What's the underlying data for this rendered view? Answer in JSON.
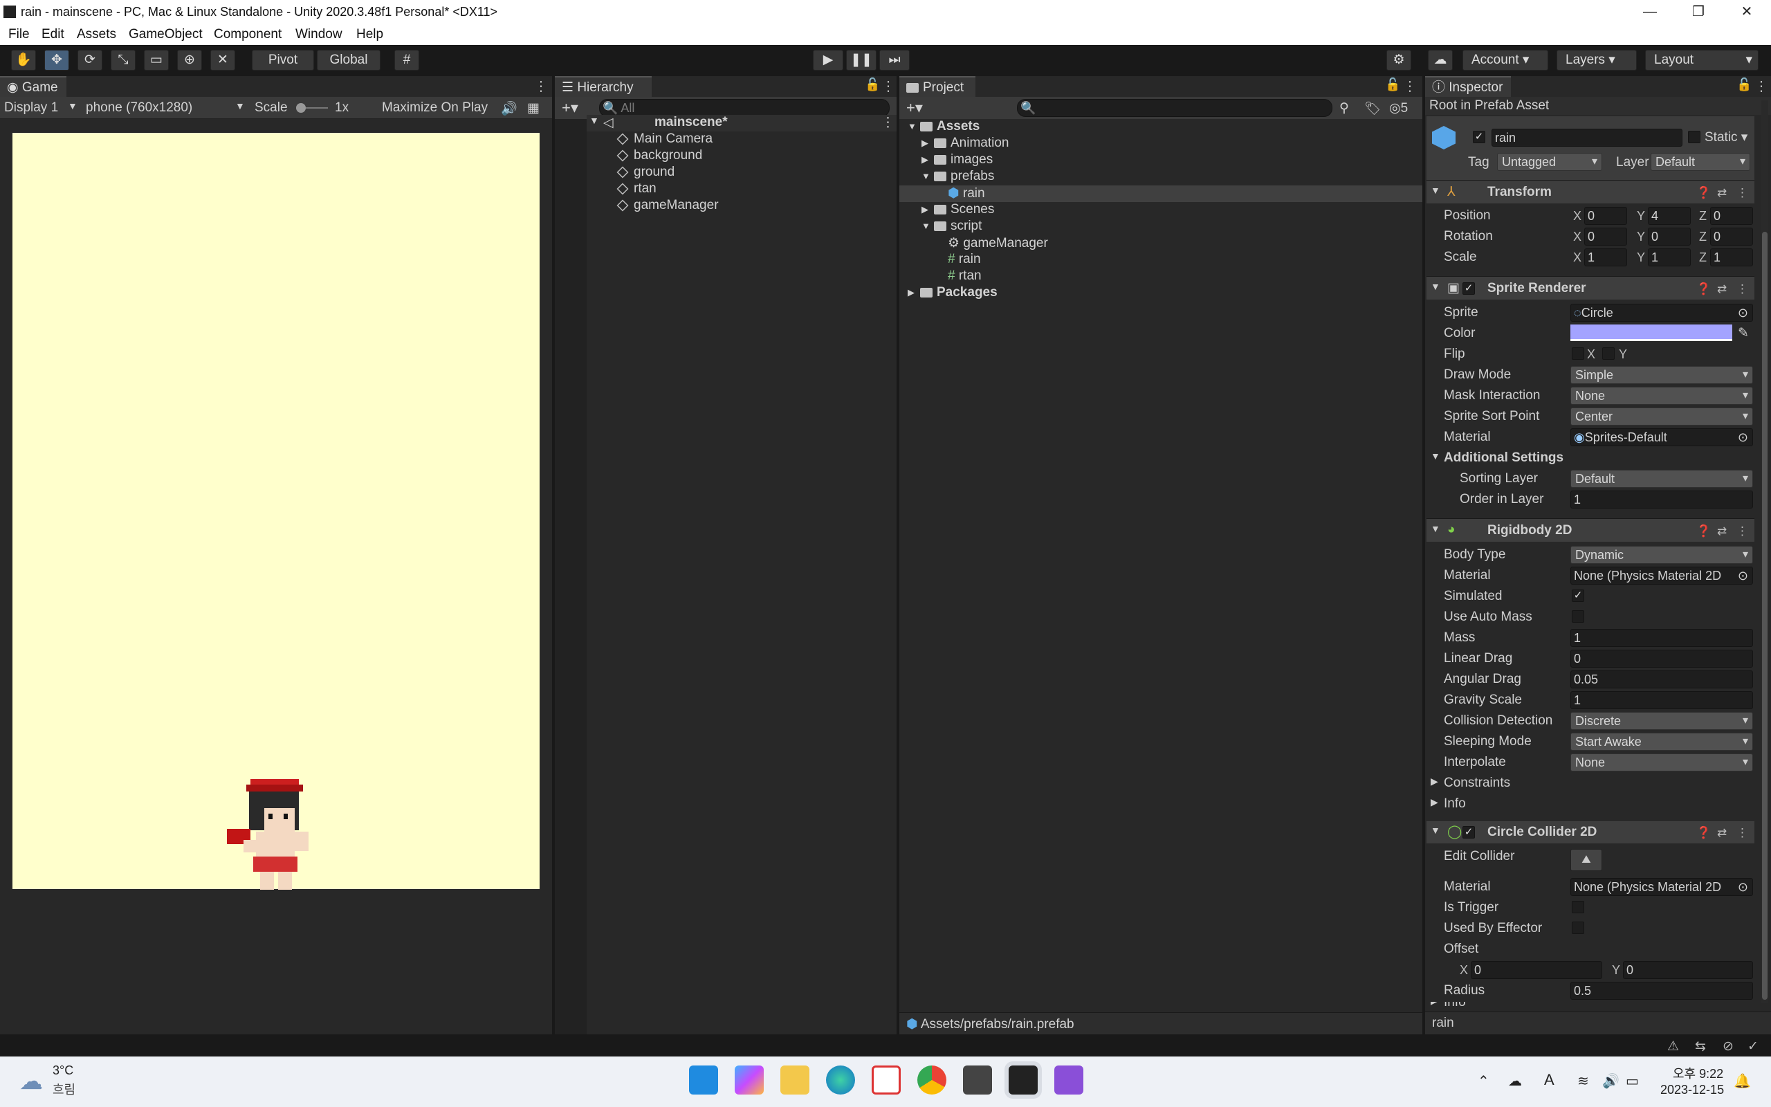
{
  "window": {
    "title": "rain - mainscene - PC, Mac & Linux Standalone - Unity 2020.3.48f1 Personal* <DX11>",
    "min": "—",
    "max": "❐",
    "close": "✕"
  },
  "menu": [
    "File",
    "Edit",
    "Assets",
    "GameObject",
    "Component",
    "Window",
    "Help"
  ],
  "toolbar": {
    "pivot": "Pivot",
    "global": "Global",
    "account": "Account",
    "layers": "Layers",
    "layout": "Layout"
  },
  "game": {
    "tab": "Game",
    "display": "Display 1",
    "resolution": "phone (760x1280)",
    "scale_label": "Scale",
    "scale_value": "1x",
    "maximize": "Maximize On Play",
    "bg_color": "#ffffcc"
  },
  "hierarchy": {
    "tab": "Hierarchy",
    "search_placeholder": "All",
    "scene": "mainscene*",
    "items": [
      "Main Camera",
      "background",
      "ground",
      "rtan",
      "gameManager"
    ]
  },
  "project": {
    "tab": "Project",
    "hidden_count": "5",
    "tree": [
      {
        "label": "Assets",
        "depth": 0,
        "type": "folder",
        "open": true,
        "bold": true
      },
      {
        "label": "Animation",
        "depth": 1,
        "type": "folder",
        "open": false
      },
      {
        "label": "images",
        "depth": 1,
        "type": "folder",
        "open": false
      },
      {
        "label": "prefabs",
        "depth": 1,
        "type": "folder",
        "open": true
      },
      {
        "label": "rain",
        "depth": 2,
        "type": "prefab",
        "selected": true
      },
      {
        "label": "Scenes",
        "depth": 1,
        "type": "folder",
        "open": false
      },
      {
        "label": "script",
        "depth": 1,
        "type": "folder",
        "open": true
      },
      {
        "label": "gameManager",
        "depth": 2,
        "type": "gear"
      },
      {
        "label": "rain",
        "depth": 2,
        "type": "script"
      },
      {
        "label": "rtan",
        "depth": 2,
        "type": "script"
      },
      {
        "label": "Packages",
        "depth": 0,
        "type": "folder",
        "open": false,
        "bold": true
      }
    ],
    "path": "Assets/prefabs/rain.prefab"
  },
  "inspector": {
    "tab": "Inspector",
    "breadcrumb": "Root in Prefab Asset",
    "name": "rain",
    "static_label": "Static",
    "tag_label": "Tag",
    "tag": "Untagged",
    "layer_label": "Layer",
    "layer": "Default",
    "transform": {
      "title": "Transform",
      "position_label": "Position",
      "position": [
        "0",
        "4",
        "0"
      ],
      "rotation_label": "Rotation",
      "rotation": [
        "0",
        "0",
        "0"
      ],
      "scale_label": "Scale",
      "scale": [
        "1",
        "1",
        "1"
      ]
    },
    "sprite_renderer": {
      "title": "Sprite Renderer",
      "sprite_label": "Sprite",
      "sprite": "Circle",
      "color_label": "Color",
      "color": "#a3a3ff",
      "flip_label": "Flip",
      "flip_x": "X",
      "flip_y": "Y",
      "draw_mode_label": "Draw Mode",
      "draw_mode": "Simple",
      "mask_label": "Mask Interaction",
      "mask": "None",
      "sort_point_label": "Sprite Sort Point",
      "sort_point": "Center",
      "material_label": "Material",
      "material": "Sprites-Default",
      "additional": "Additional Settings",
      "sorting_layer_label": "Sorting Layer",
      "sorting_layer": "Default",
      "order_label": "Order in Layer",
      "order": "1"
    },
    "rigidbody": {
      "title": "Rigidbody 2D",
      "body_type_label": "Body Type",
      "body_type": "Dynamic",
      "material_label": "Material",
      "material": "None (Physics Material 2D",
      "simulated_label": "Simulated",
      "auto_mass_label": "Use Auto Mass",
      "mass_label": "Mass",
      "mass": "1",
      "linear_label": "Linear Drag",
      "linear": "0",
      "angular_label": "Angular Drag",
      "angular": "0.05",
      "gravity_label": "Gravity Scale",
      "gravity": "1",
      "collision_label": "Collision Detection",
      "collision": "Discrete",
      "sleeping_label": "Sleeping Mode",
      "sleeping": "Start Awake",
      "interpolate_label": "Interpolate",
      "interpolate": "None",
      "constraints": "Constraints",
      "info": "Info"
    },
    "circle_collider": {
      "title": "Circle Collider 2D",
      "edit_label": "Edit Collider",
      "material_label": "Material",
      "material": "None (Physics Material 2D",
      "trigger_label": "Is Trigger",
      "effector_label": "Used By Effector",
      "offset_label": "Offset",
      "offset": [
        "0",
        "0"
      ],
      "radius_label": "Radius",
      "radius": "0.5",
      "info": "Info"
    },
    "footer": "rain"
  },
  "taskbar": {
    "temp": "3°C",
    "weather": "흐림",
    "time": "오후 9:22",
    "date": "2023-12-15",
    "ime": "A"
  }
}
